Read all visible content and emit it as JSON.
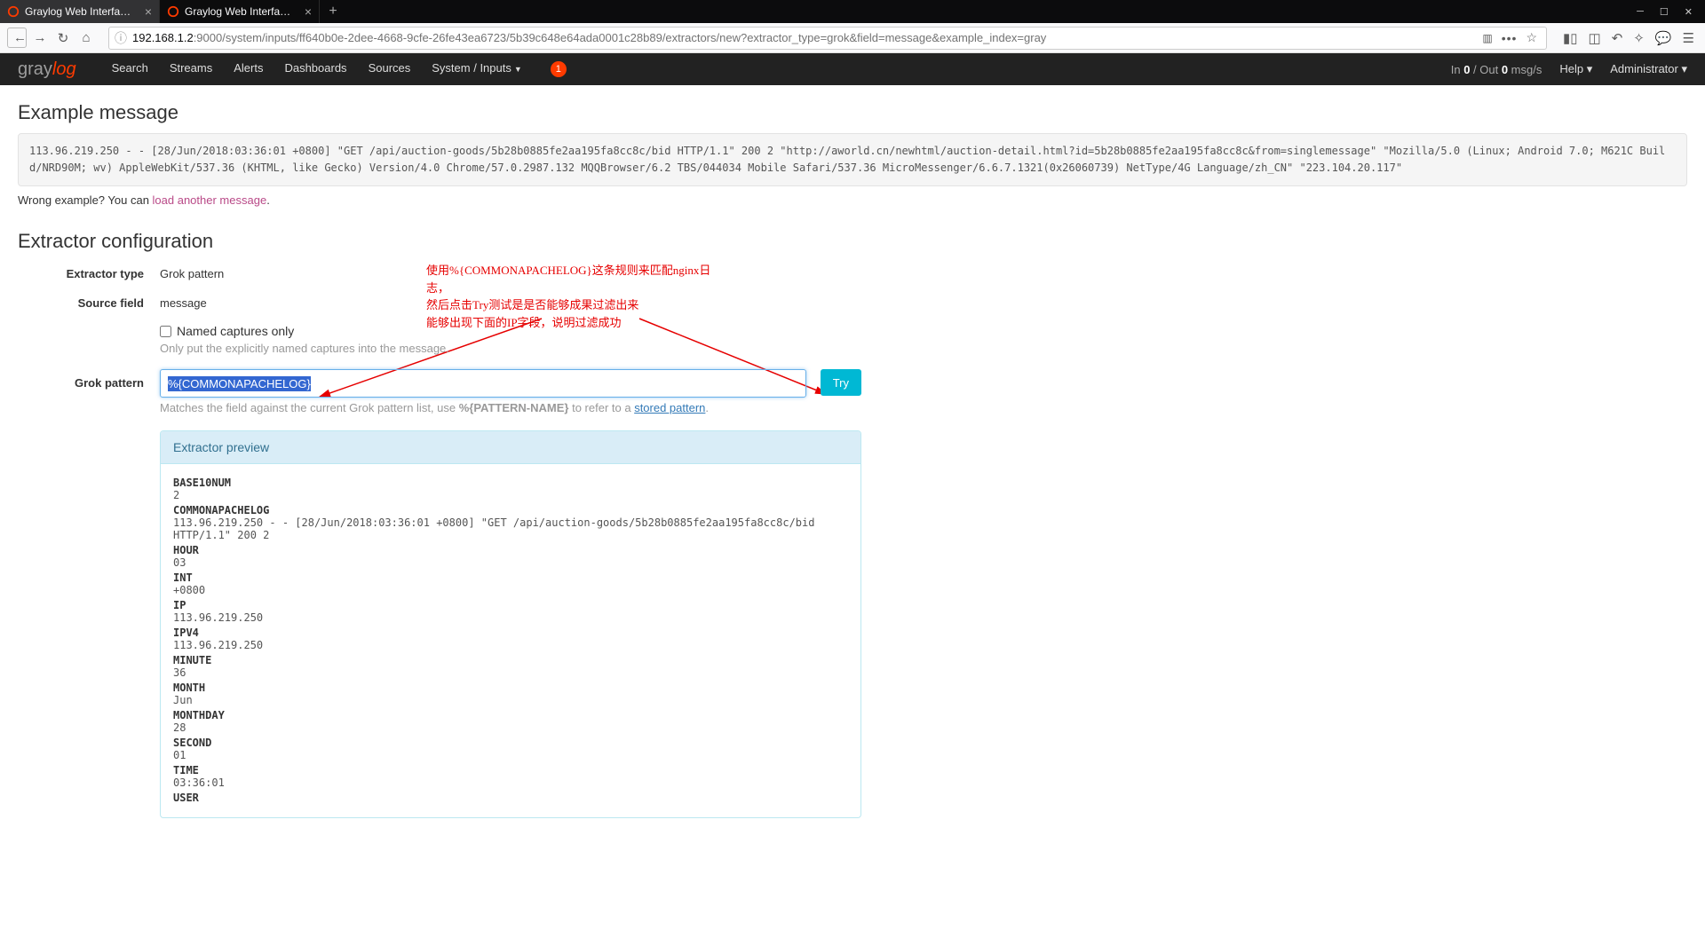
{
  "tabs": [
    {
      "title": "Graylog Web Interface - New"
    },
    {
      "title": "Graylog Web Interface - Gro"
    }
  ],
  "url_host": "192.168.1.2",
  "url_path": ":9000/system/inputs/ff640b0e-2dee-4668-9cfe-26fe43ea6723/5b39c648e64ada0001c28b89/extractors/new?extractor_type=grok&field=message&example_index=gray",
  "nav": {
    "search": "Search",
    "streams": "Streams",
    "alerts": "Alerts",
    "dashboards": "Dashboards",
    "sources": "Sources",
    "system": "System / Inputs",
    "badge": "1",
    "inout": "In 0 / Out 0 msg/s",
    "help": "Help",
    "admin": "Administrator"
  },
  "sections": {
    "example": "Example message",
    "config": "Extractor configuration"
  },
  "example_msg": "113.96.219.250 - - [28/Jun/2018:03:36:01 +0800] \"GET /api/auction-goods/5b28b0885fe2aa195fa8cc8c/bid HTTP/1.1\" 200 2 \"http://aworld.cn/newhtml/auction-detail.html?id=5b28b0885fe2aa195fa8cc8c&from=singlemessage\" \"Mozilla/5.0 (Linux; Android 7.0; M621C Build/NRD90M; wv) AppleWebKit/537.36 (KHTML, like Gecko) Version/4.0 Chrome/57.0.2987.132 MQQBrowser/6.2 TBS/044034 Mobile Safari/537.36 MicroMessenger/6.6.7.1321(0x26060739) NetType/4G Language/zh_CN\" \"223.104.20.117\"",
  "wrong_prefix": "Wrong example? You can ",
  "wrong_link": "load another message",
  "labels": {
    "extractor_type": "Extractor type",
    "source_field": "Source field",
    "grok": "Grok pattern"
  },
  "values": {
    "extractor_type": "Grok pattern",
    "source_field": "message",
    "named_captures": "Named captures only",
    "named_hint": "Only put the explicitly named captures into the message.",
    "grok_value": "%{COMMONAPACHELOG}",
    "grok_hint_pre": "Matches the field against the current Grok pattern list, use ",
    "grok_hint_pat": "%{PATTERN-NAME}",
    "grok_hint_mid": " to refer to a ",
    "grok_hint_link": "stored pattern",
    "try": "Try"
  },
  "annot": [
    "使用%{COMMONAPACHELOG}这条规则来匹配nginx日志，",
    "然后点击Try测试是是否能够成果过滤出来",
    "能够出现下面的IP字段，说明过滤成功"
  ],
  "preview_title": "Extractor preview",
  "preview": [
    {
      "k": "BASE10NUM",
      "v": "2"
    },
    {
      "k": "COMMONAPACHELOG",
      "v": "113.96.219.250 - - [28/Jun/2018:03:36:01 +0800] \"GET /api/auction-goods/5b28b0885fe2aa195fa8cc8c/bid HTTP/1.1\" 200 2"
    },
    {
      "k": "HOUR",
      "v": "03"
    },
    {
      "k": "INT",
      "v": "+0800"
    },
    {
      "k": "IP",
      "v": "113.96.219.250"
    },
    {
      "k": "IPV4",
      "v": "113.96.219.250"
    },
    {
      "k": "MINUTE",
      "v": "36"
    },
    {
      "k": "MONTH",
      "v": "Jun"
    },
    {
      "k": "MONTHDAY",
      "v": "28"
    },
    {
      "k": "SECOND",
      "v": "01"
    },
    {
      "k": "TIME",
      "v": "03:36:01"
    },
    {
      "k": "USER",
      "v": ""
    }
  ]
}
